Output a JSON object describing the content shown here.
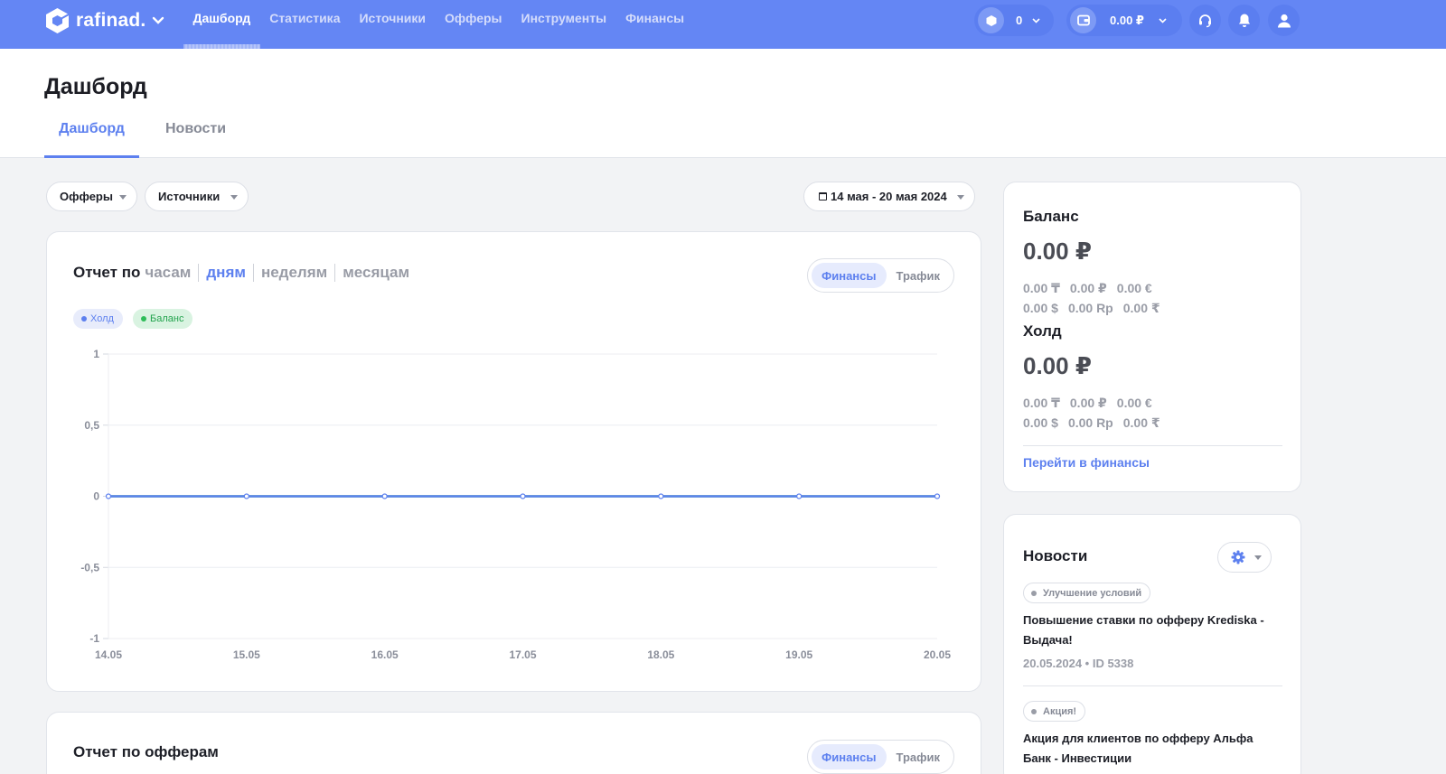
{
  "brand": {
    "name": "rafinad."
  },
  "nav": [
    "Дашборд",
    "Статистика",
    "Источники",
    "Офферы",
    "Инструменты",
    "Финансы"
  ],
  "topbar": {
    "coins_value": "0",
    "wallet_value": "0.00 ₽"
  },
  "page": {
    "title": "Дашборд",
    "tabs": [
      "Дашборд",
      "Новости"
    ]
  },
  "filters": {
    "offers": "Офферы",
    "sources": "Источники",
    "date_range": "14 мая - 20 мая 2024"
  },
  "report": {
    "prefix": "Отчет по",
    "periods": [
      "часам",
      "дням",
      "неделям",
      "месяцам"
    ],
    "active_period": "дням",
    "toggle": [
      "Финансы",
      "Трафик"
    ],
    "legend": [
      "Холд",
      "Баланс"
    ]
  },
  "chart_data": {
    "type": "line",
    "x": [
      "14.05",
      "15.05",
      "16.05",
      "17.05",
      "18.05",
      "19.05",
      "20.05"
    ],
    "y_ticks": [
      "1",
      "0,5",
      "0",
      "-0,5",
      "-1"
    ],
    "ylim": [
      -1,
      1
    ],
    "series": [
      {
        "name": "Холд",
        "values": [
          0,
          0,
          0,
          0,
          0,
          0,
          0
        ],
        "color": "#5d80ef"
      },
      {
        "name": "Баланс",
        "values": [
          0,
          0,
          0,
          0,
          0,
          0,
          0
        ],
        "color": "#2ebd59"
      }
    ],
    "grid": true
  },
  "offers_report": {
    "title": "Отчет по офферам",
    "toggle": [
      "Финансы",
      "Трафик"
    ]
  },
  "balance": {
    "title": "Баланс",
    "amount": "0.00 ₽",
    "currencies_row1": [
      "0.00 ₸",
      "0.00 ₽",
      "0.00 €"
    ],
    "currencies_row2": [
      "0.00 $",
      "0.00 Rp",
      "0.00 ₹"
    ],
    "hold_title": "Холд",
    "hold_amount": "0.00 ₽",
    "hold_row1": [
      "0.00 ₸",
      "0.00 ₽",
      "0.00 €"
    ],
    "hold_row2": [
      "0.00 $",
      "0.00 Rp",
      "0.00 ₹"
    ],
    "link": "Перейти в финансы"
  },
  "news": {
    "title": "Новости",
    "items": [
      {
        "tag": "Улучшение условий",
        "text": "Повышение ставки по офферу Krediska - Выдача!",
        "meta": "20.05.2024 • ID 5338"
      },
      {
        "tag": "Акция!",
        "text": "Акция для клиентов по офферу Альфа Банк - Инвестиции"
      }
    ]
  },
  "colors": {
    "accent": "#5d80ef",
    "topbar": "#6486f4",
    "hold": "#5d80ef",
    "balance": "#2ebd59"
  }
}
